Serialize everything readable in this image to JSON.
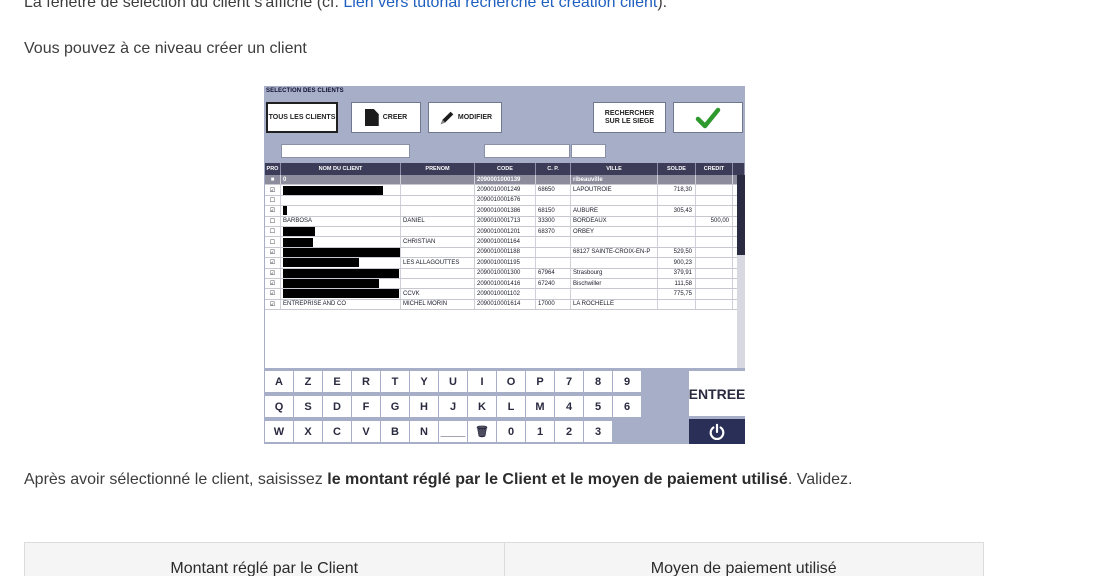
{
  "intro": {
    "text_before_link": "La fenêtre de sélection du client s'affiche (cf. ",
    "link": "Lien vers tutorial recherche et création client",
    "text_after_link": ")."
  },
  "create_text": "Vous pouvez à ce niveau créer un client",
  "app": {
    "title": "SELECTION DES CLIENTS",
    "buttons": {
      "all_clients": "TOUS LES CLIENTS",
      "create": "CREER",
      "modify": "MODIFIER",
      "search_l1": "RECHERCHER",
      "search_l2": "SUR LE SIEGE"
    },
    "columns": {
      "pro": "PRO",
      "name": "NOM DU CLIENT",
      "firstname": "PRENOM",
      "code": "CODE",
      "cp": "C. P.",
      "city": "VILLE",
      "balance": "SOLDE",
      "credit": "CREDIT"
    },
    "rows": [
      {
        "check": "■",
        "name": "0",
        "first": "",
        "code": "2090001000139",
        "cp": "",
        "city": "ribeauville",
        "balance": "",
        "credit": ""
      },
      {
        "check": "☑",
        "name": "",
        "first": "",
        "code": "2090010001249",
        "cp": "68650",
        "city": "LAPOUTROIE",
        "balance": "718,30",
        "credit": ""
      },
      {
        "check": "☐",
        "name": "",
        "first": "",
        "code": "2090010001676",
        "cp": "",
        "city": "",
        "balance": "",
        "credit": ""
      },
      {
        "check": "☑",
        "name": "",
        "first": "",
        "code": "2090010001386",
        "cp": "68150",
        "city": "AUBURE",
        "balance": "305,43",
        "credit": ""
      },
      {
        "check": "☐",
        "name": "BARBOSA",
        "first": "DANIEL",
        "code": "2090010001713",
        "cp": "33300",
        "city": "BORDEAUX",
        "balance": "",
        "credit": "500,00"
      },
      {
        "check": "☐",
        "name": "",
        "first": "",
        "code": "2090010001201",
        "cp": "68370",
        "city": "ORBEY",
        "balance": "",
        "credit": ""
      },
      {
        "check": "☐",
        "name": "",
        "first": "CHRISTIAN",
        "code": "2090010001164",
        "cp": "",
        "city": "",
        "balance": "",
        "credit": ""
      },
      {
        "check": "☑",
        "name": "",
        "first": "",
        "code": "2090010001188",
        "cp": "",
        "city": "68127 SAINTE-CROIX-EN-P",
        "balance": "529,50",
        "credit": ""
      },
      {
        "check": "☑",
        "name": "",
        "first": "LES ALLAGOUTTES",
        "code": "2090010001195",
        "cp": "",
        "city": "",
        "balance": "900,23",
        "credit": ""
      },
      {
        "check": "☑",
        "name": "",
        "first": "",
        "code": "2090010001300",
        "cp": "67964",
        "city": "Strasbourg",
        "balance": "379,91",
        "credit": ""
      },
      {
        "check": "☑",
        "name": "",
        "first": "",
        "code": "2090010001416",
        "cp": "67240",
        "city": "Bischwiller",
        "balance": "111,58",
        "credit": ""
      },
      {
        "check": "☑",
        "name": "",
        "first": "CCVK",
        "code": "2090010001102",
        "cp": "",
        "city": "",
        "balance": "775,75",
        "credit": ""
      },
      {
        "check": "☑",
        "name": "ENTREPRISE AND CO",
        "first": "MICHEL MORIN",
        "code": "2090010001614",
        "cp": "17000",
        "city": "LA ROCHELLE",
        "balance": "",
        "credit": ""
      }
    ],
    "keyboard": {
      "row1": [
        "A",
        "Z",
        "E",
        "R",
        "T",
        "Y",
        "U",
        "I",
        "O",
        "P",
        "7",
        "8",
        "9"
      ],
      "row2": [
        "Q",
        "S",
        "D",
        "F",
        "G",
        "H",
        "J",
        "K",
        "L",
        "M",
        "4",
        "5",
        "6"
      ],
      "row3": [
        "W",
        "X",
        "C",
        "V",
        "B",
        "N",
        "____",
        "🗑",
        "0",
        "1",
        "2",
        "3"
      ],
      "enter": "ENTREE"
    }
  },
  "after": {
    "before": "Après avoir sélectionné le client, saisissez ",
    "bold": "le montant réglé par le Client et le moyen de paiement utilisé",
    "after": ". Validez."
  },
  "table_headers": [
    "Montant réglé par le Client",
    "Moyen de paiement utilisé"
  ]
}
